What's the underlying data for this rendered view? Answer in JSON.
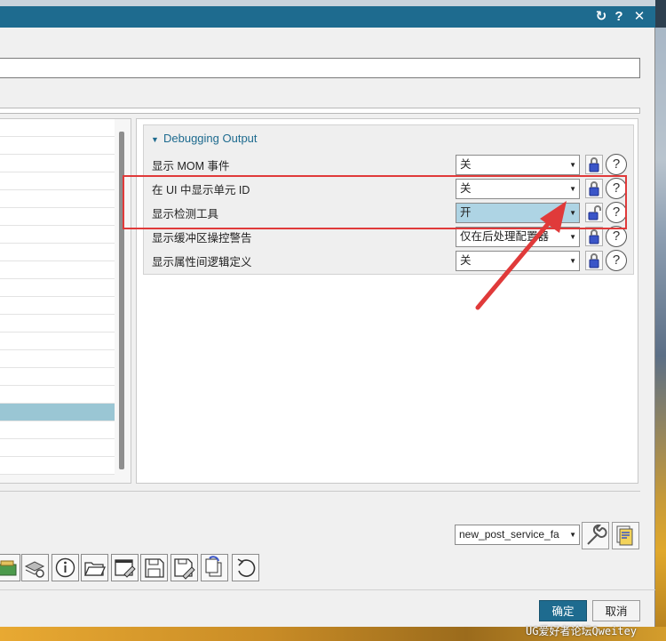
{
  "titlebar": {
    "buttons": [
      "↻",
      "?",
      "✕"
    ]
  },
  "debug_group": {
    "title": "Debugging Output",
    "rows": [
      {
        "label": "显示 MOM 事件",
        "value": "关",
        "highlighted": false
      },
      {
        "label": "在 UI 中显示单元 ID",
        "value": "关",
        "highlighted": false
      },
      {
        "label": "显示检测工具",
        "value": "开",
        "highlighted": true
      },
      {
        "label": "显示缓冲区操控警告",
        "value": "仅在后处理配置器",
        "highlighted": false
      },
      {
        "label": "显示属性间逻辑定义",
        "value": "关",
        "highlighted": false
      }
    ],
    "help_glyph": "?"
  },
  "bottom": {
    "service_combo_value": "new_post_service_fa"
  },
  "toolbar_icons": [
    "package-icon",
    "layers-gear-icon",
    "info-icon",
    "open-folder-icon",
    "edit-window-icon",
    "save-icon",
    "save-as-icon",
    "copy-icon",
    "undo-icon"
  ],
  "footer": {
    "ok_label": "确定",
    "cancel_label": "取消"
  },
  "watermark": "UG爱好者论坛Qweitey",
  "colors": {
    "title_bar": "#1e6b8f",
    "accent": "#1e6b8f",
    "selection": "#9ac6d4",
    "annotation": "#e03a3a"
  }
}
